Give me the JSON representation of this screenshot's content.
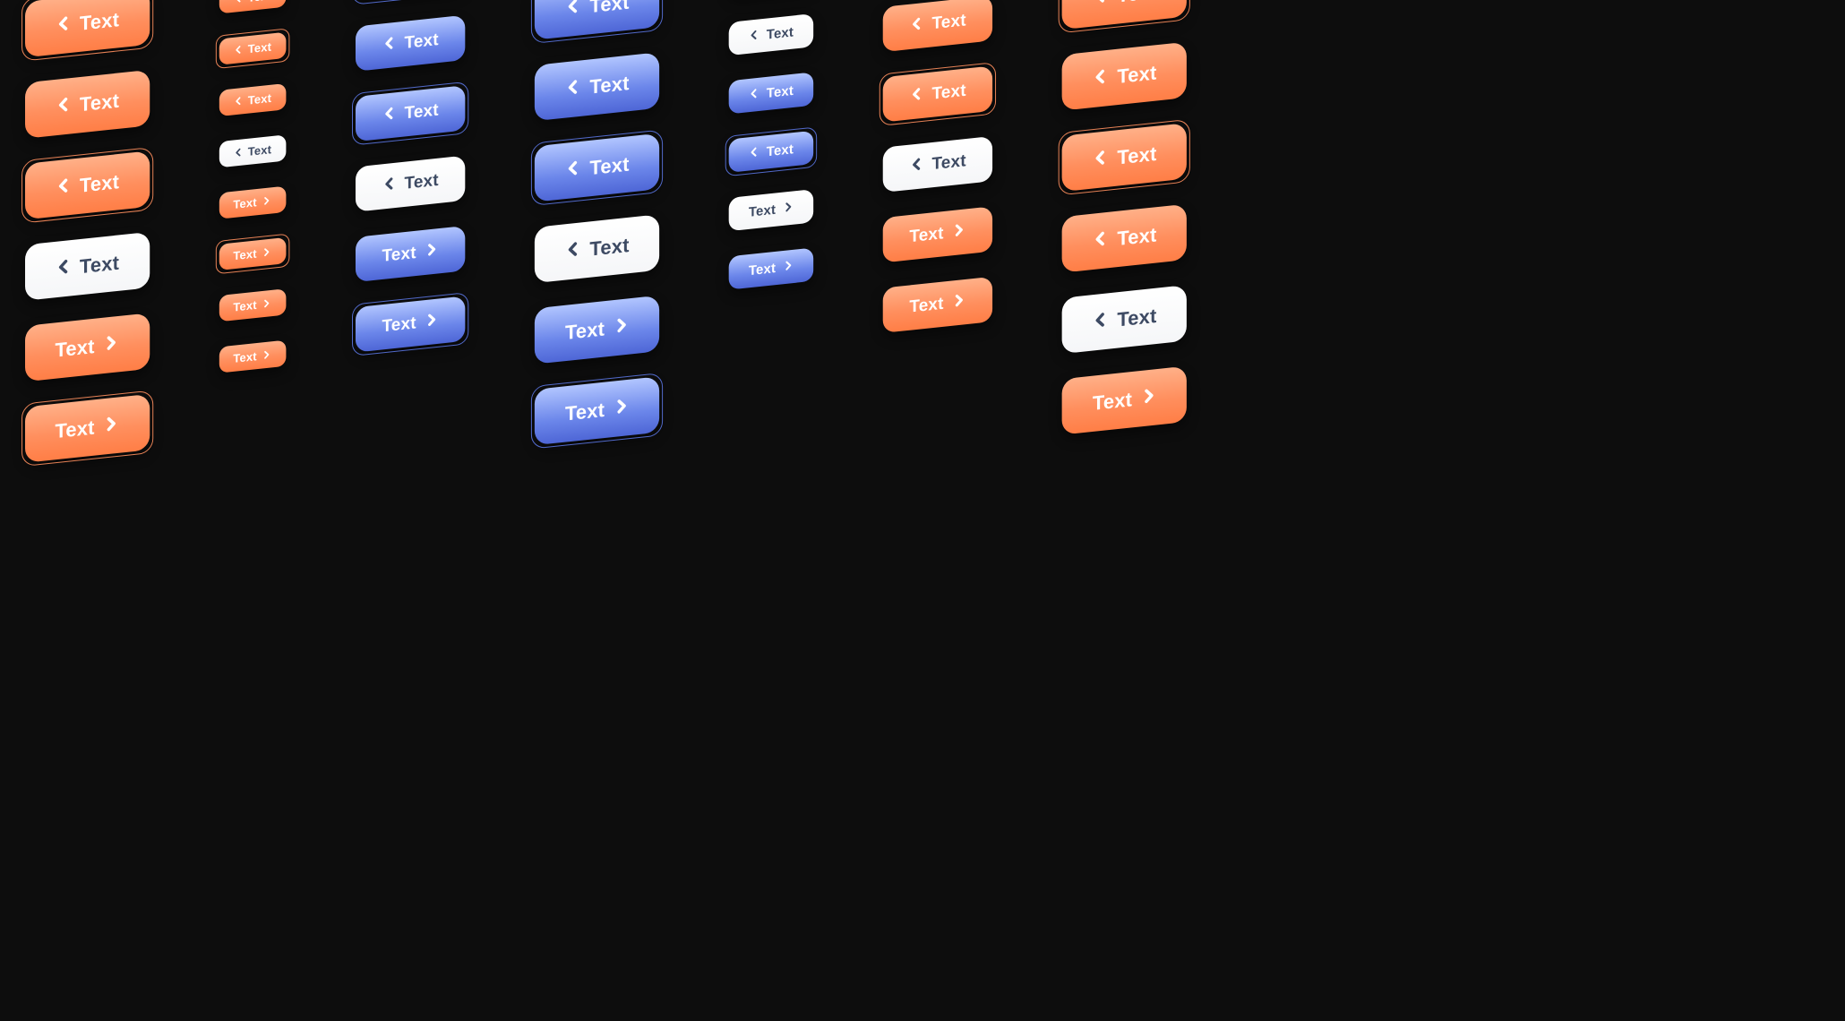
{
  "label": "Text",
  "colors": {
    "orange": "#ff8f5e",
    "blue": "#5a74e0",
    "white": "#ffffff",
    "bg": "#0d0d0d"
  },
  "columns": [
    {
      "variant": "orange",
      "size": "md",
      "items": [
        {
          "dir": "left",
          "b": false
        },
        {
          "dir": "left",
          "b": false
        },
        {
          "dir": "left",
          "b": false
        },
        {
          "dir": "left",
          "b": false
        },
        {
          "dir": "left",
          "b": true,
          "variant": "white"
        },
        {
          "dir": "right",
          "b": false
        },
        {
          "dir": "right",
          "b": false
        }
      ]
    },
    {
      "variant": "orange",
      "size": "lg",
      "items": [
        {
          "dir": "left",
          "b": false
        },
        {
          "dir": "left",
          "b": true
        },
        {
          "dir": "left",
          "b": false
        },
        {
          "dir": "left",
          "b": true
        },
        {
          "dir": "left",
          "b": false,
          "variant": "white"
        },
        {
          "dir": "right",
          "b": false
        },
        {
          "dir": "right",
          "b": true
        }
      ]
    },
    {
      "variant": "orange",
      "size": "xs",
      "items": [
        {
          "dir": "left",
          "b": false
        },
        {
          "dir": "left",
          "b": false
        },
        {
          "dir": "left",
          "b": true
        },
        {
          "dir": "left",
          "b": false
        },
        {
          "dir": "left",
          "b": false,
          "variant": "white"
        },
        {
          "dir": "right",
          "b": false
        },
        {
          "dir": "right",
          "b": true
        },
        {
          "dir": "right",
          "b": false
        },
        {
          "dir": "right",
          "b": false
        }
      ]
    },
    {
      "variant": "blue",
      "size": "md",
      "items": [
        {
          "dir": "left",
          "b": false
        },
        {
          "dir": "left",
          "b": true
        },
        {
          "dir": "left",
          "b": false
        },
        {
          "dir": "left",
          "b": true
        },
        {
          "dir": "left",
          "b": false,
          "variant": "white"
        },
        {
          "dir": "right",
          "b": false
        },
        {
          "dir": "right",
          "b": true
        }
      ]
    },
    {
      "variant": "blue",
      "size": "lg",
      "items": [
        {
          "dir": "left",
          "b": false
        },
        {
          "dir": "left",
          "b": true
        },
        {
          "dir": "left",
          "b": false
        },
        {
          "dir": "left",
          "b": true
        },
        {
          "dir": "left",
          "b": false,
          "variant": "white"
        },
        {
          "dir": "right",
          "b": false
        },
        {
          "dir": "right",
          "b": true
        }
      ]
    },
    {
      "variant": "blue",
      "size": "sm",
      "items": [
        {
          "dir": "left",
          "b": false
        },
        {
          "dir": "left",
          "b": true
        },
        {
          "dir": "left",
          "b": false
        },
        {
          "dir": "left",
          "b": false,
          "variant": "white"
        },
        {
          "dir": "left",
          "b": false
        },
        {
          "dir": "left",
          "b": true
        },
        {
          "dir": "right",
          "b": false,
          "variant": "white"
        },
        {
          "dir": "right",
          "b": false
        }
      ]
    },
    {
      "variant": "orange",
      "size": "md",
      "items": [
        {
          "dir": "left",
          "b": false
        },
        {
          "dir": "left",
          "b": true
        },
        {
          "dir": "left",
          "b": false
        },
        {
          "dir": "left",
          "b": true
        },
        {
          "dir": "left",
          "b": false,
          "variant": "white"
        },
        {
          "dir": "right",
          "b": false
        },
        {
          "dir": "right",
          "b": false
        }
      ]
    },
    {
      "variant": "orange",
      "size": "lg",
      "items": [
        {
          "dir": "left",
          "b": false,
          "variant": "white"
        },
        {
          "dir": "left",
          "b": false
        },
        {
          "dir": "left",
          "b": true
        },
        {
          "dir": "left",
          "b": false
        },
        {
          "dir": "left",
          "b": true
        },
        {
          "dir": "left",
          "b": false
        },
        {
          "dir": "left",
          "b": false,
          "variant": "white"
        },
        {
          "dir": "right",
          "b": false
        }
      ]
    }
  ]
}
